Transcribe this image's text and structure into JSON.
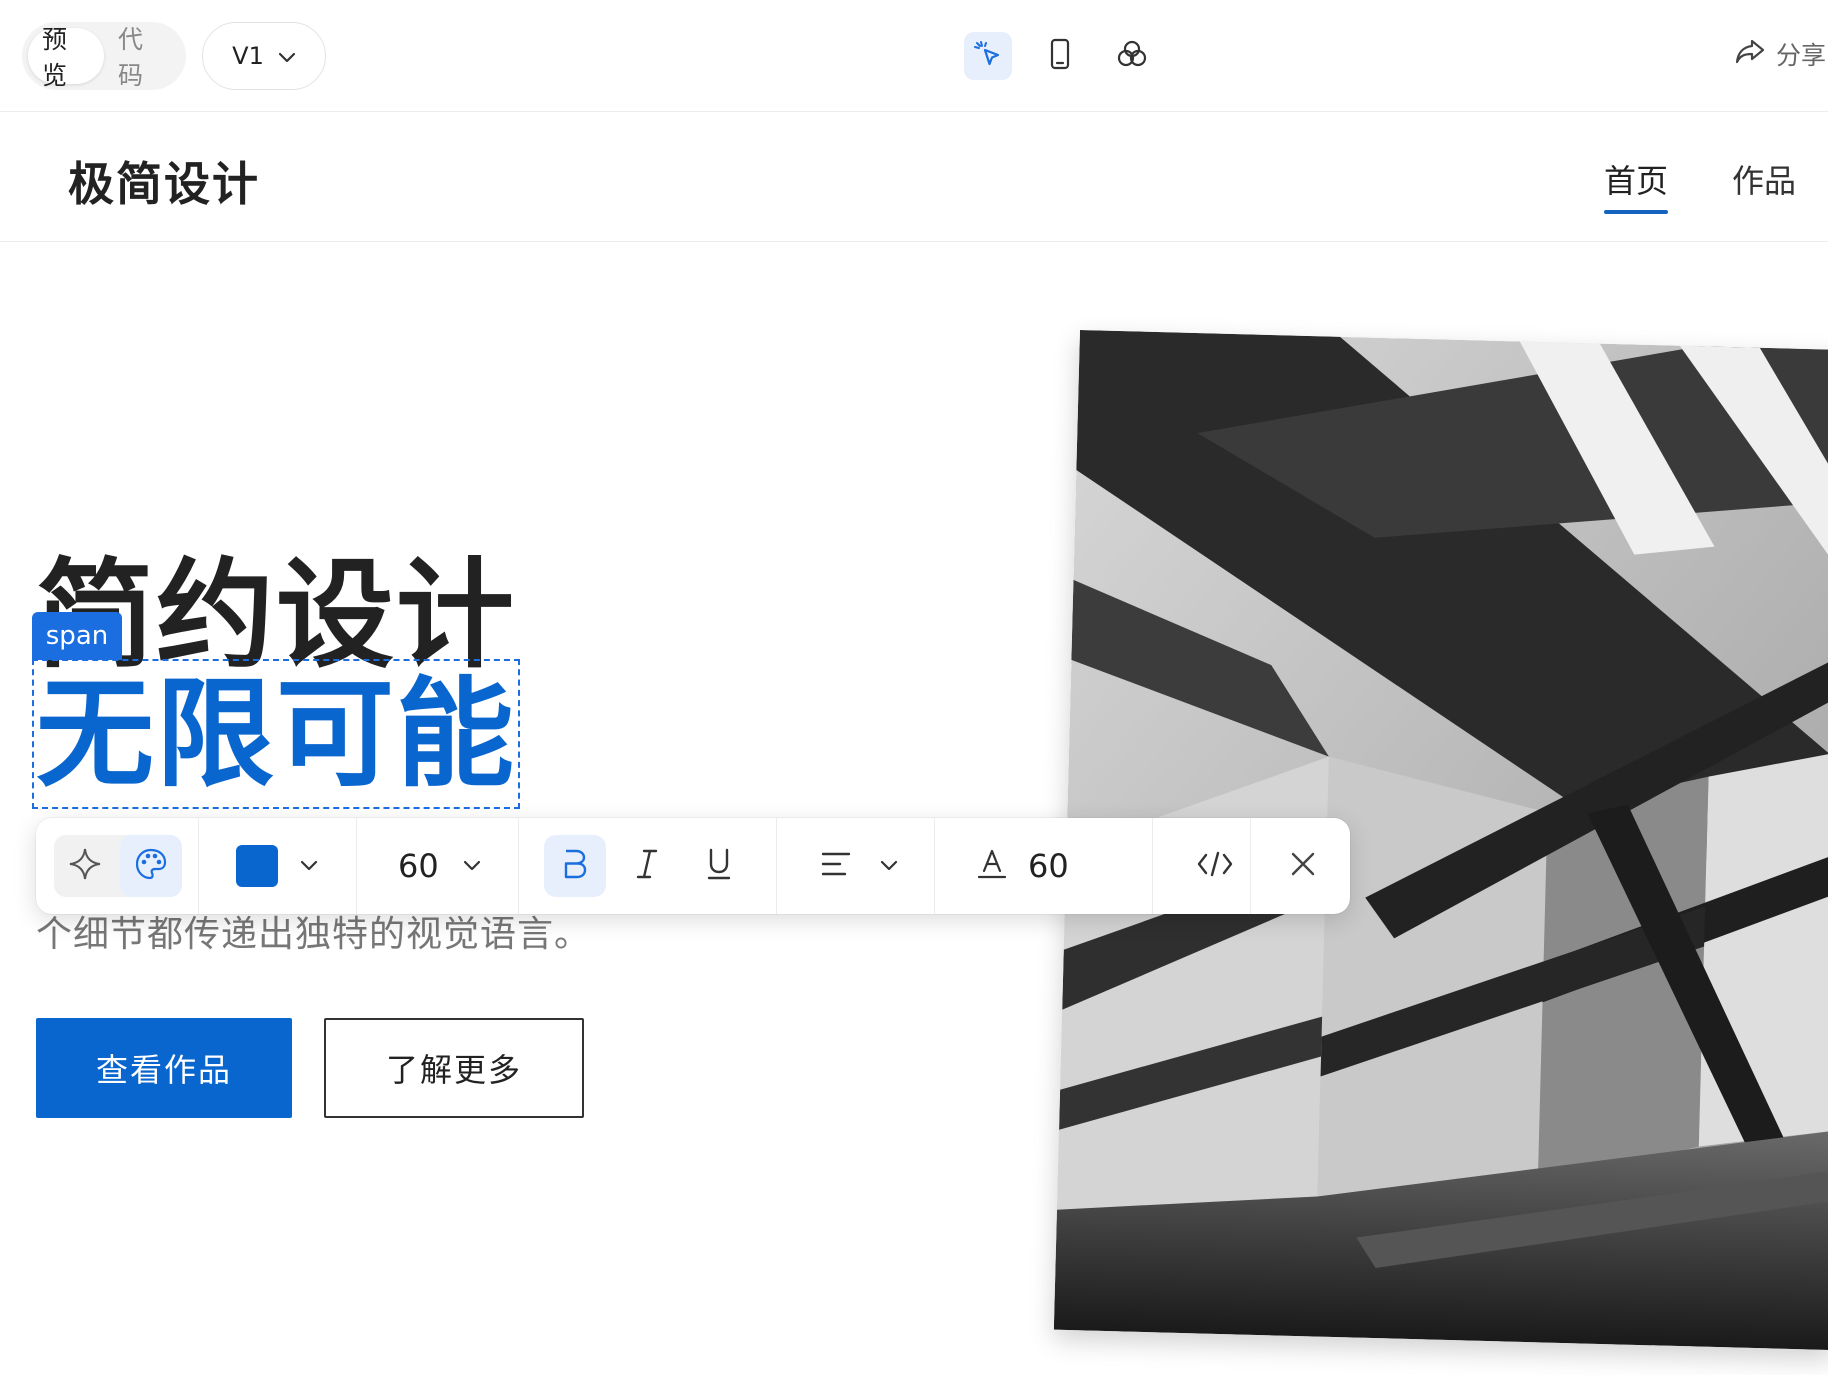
{
  "appbar": {
    "view_tabs": [
      "预览",
      "代码"
    ],
    "active_view": "预览",
    "version": "V1",
    "share_label": "分享"
  },
  "site": {
    "brand": "极简设计",
    "nav": [
      {
        "label": "首页",
        "active": true
      },
      {
        "label": "作品",
        "active": false
      }
    ]
  },
  "hero": {
    "line1": "简约设计",
    "line2": "无限可能",
    "selected_tag": "span",
    "subtext": "个细节都传递出独特的视觉语言。",
    "primary_button": "查看作品",
    "secondary_button": "了解更多"
  },
  "toolbar": {
    "font_size": "60",
    "line_height": "60",
    "text_color": "#0a66cf"
  },
  "colors": {
    "accent": "#0a66cf",
    "selection": "#1a6ee0"
  }
}
